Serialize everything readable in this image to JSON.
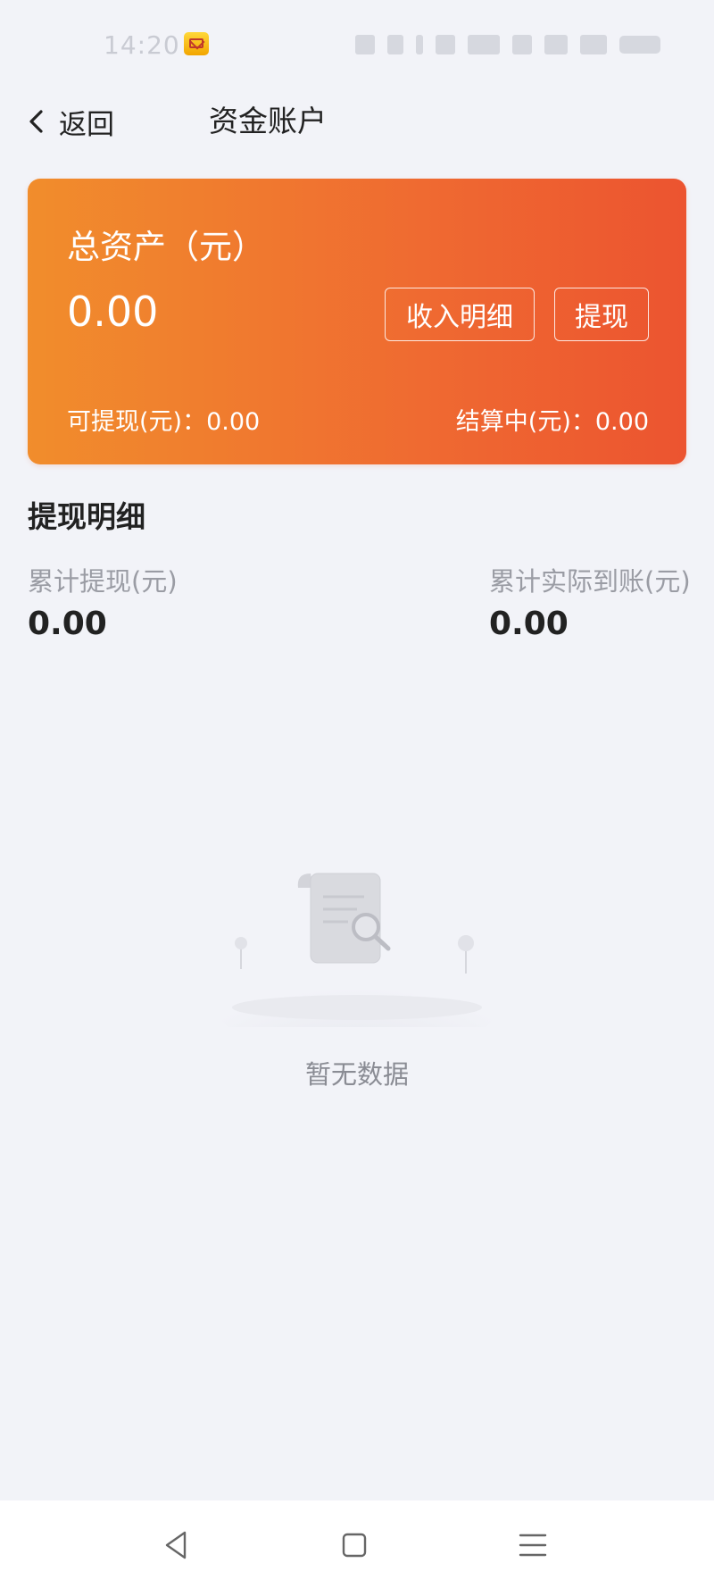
{
  "status_bar": {
    "time": "14:20"
  },
  "nav": {
    "back_label": "返回",
    "title": "资金账户"
  },
  "asset_card": {
    "title": "总资产（元）",
    "total_amount": "0.00",
    "income_detail_button": "收入明细",
    "withdraw_button": "提现",
    "available_label": "可提现(元)：",
    "available_value": "0.00",
    "settling_label": "结算中(元)：",
    "settling_value": "0.00",
    "gradient_start": "#f18d2c",
    "gradient_end": "#ec5430"
  },
  "withdraw_details": {
    "title": "提现明细",
    "total_withdrawn_label": "累计提现(元)",
    "total_withdrawn_value": "0.00",
    "total_received_label": "累计实际到账(元)",
    "total_received_value": "0.00"
  },
  "empty_state": {
    "text": "暂无数据",
    "icon": "empty-document-search-icon"
  },
  "system_nav": {
    "back_icon": "triangle-back-icon",
    "home_icon": "square-home-icon",
    "menu_icon": "three-line-menu-icon"
  }
}
